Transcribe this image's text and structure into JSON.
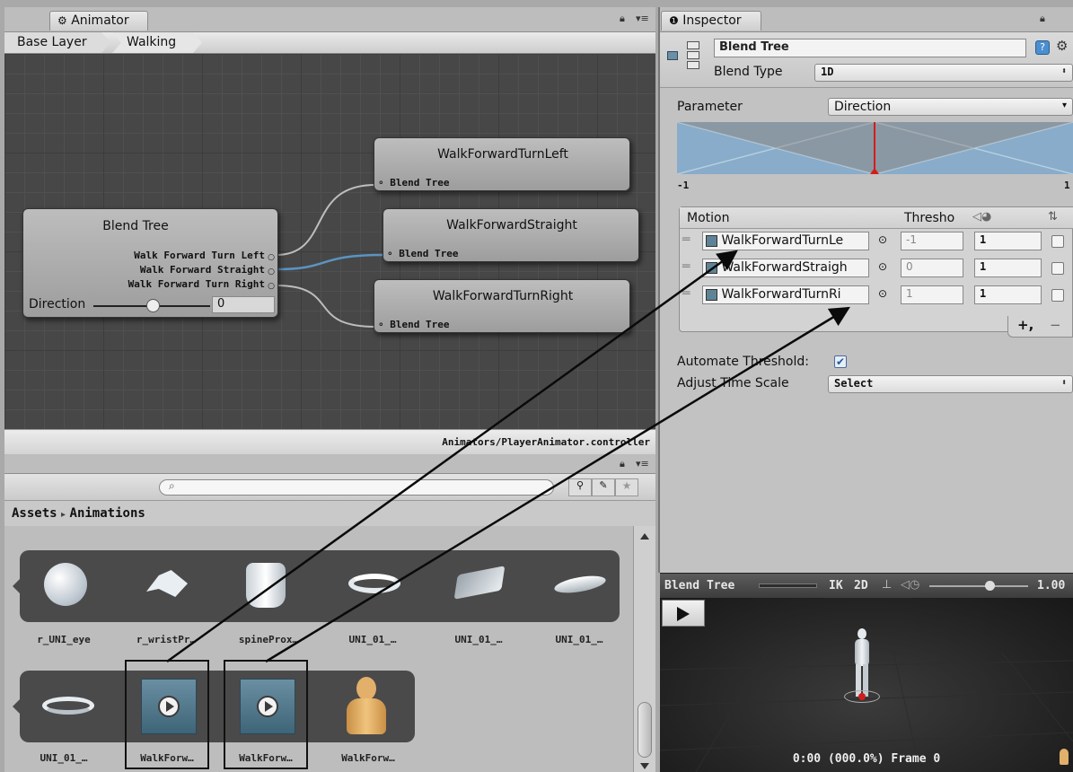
{
  "animator": {
    "tab_label": "Animator",
    "breadcrumb": [
      "Base Layer",
      "Walking"
    ],
    "status_path": "Animators/PlayerAnimator.controller",
    "root_node": {
      "title": "Blend Tree",
      "outputs": [
        "Walk Forward Turn Left",
        "Walk Forward Straight",
        "Walk Forward Turn Right"
      ],
      "param_label": "Direction",
      "param_value": "0"
    },
    "child_nodes": [
      {
        "title": "WalkForwardTurnLeft",
        "port": "Blend Tree"
      },
      {
        "title": "WalkForwardStraight",
        "port": "Blend Tree"
      },
      {
        "title": "WalkForwardTurnRight",
        "port": "Blend Tree"
      }
    ],
    "param_slider_fraction": 0.5
  },
  "project": {
    "search_placeholder": "",
    "breadcrumb_root": "Assets",
    "breadcrumb_sep": "▸",
    "breadcrumb_current": "Animations",
    "assets_row1": [
      {
        "label": "r_UNI_eye",
        "icon": "sphere-mesh-icon"
      },
      {
        "label": "r_wristPr…",
        "icon": "wrist-mesh-icon"
      },
      {
        "label": "spineProx…",
        "icon": "spine-mesh-icon"
      },
      {
        "label": "UNI_01_…",
        "icon": "ring-mesh-icon"
      },
      {
        "label": "UNI_01_…",
        "icon": "plate-mesh-icon"
      },
      {
        "label": "UNI_01_…",
        "icon": "disc-mesh-icon"
      }
    ],
    "assets_row2": [
      {
        "label": "UNI_01_…",
        "icon": "band-mesh-icon"
      },
      {
        "label": "WalkForw…",
        "icon": "animation-clip-icon"
      },
      {
        "label": "WalkForw…",
        "icon": "animation-clip-icon"
      },
      {
        "label": "WalkForw…",
        "icon": "avatar-icon"
      }
    ]
  },
  "inspector": {
    "tab_label": "Inspector",
    "name_value": "Blend Tree",
    "blend_type_label": "Blend Type",
    "blend_type_value": "1D",
    "parameter_label": "Parameter",
    "parameter_value": "Direction",
    "range_min": "-1",
    "range_max": "1",
    "table_headers": {
      "motion": "Motion",
      "threshold": "Thresho"
    },
    "motions": [
      {
        "name": "WalkForwardTurnLe",
        "threshold": "-1",
        "speed": "1"
      },
      {
        "name": "WalkForwardStraigh",
        "threshold": "0",
        "speed": "1"
      },
      {
        "name": "WalkForwardTurnRi",
        "threshold": "1",
        "speed": "1"
      }
    ],
    "add_label": "+,",
    "remove_label": "−",
    "automate_label": "Automate Threshold",
    "automate_checked": true,
    "adjust_label": "Adjust Time Scale",
    "adjust_value": "Select"
  },
  "preview": {
    "title": "Blend Tree",
    "ik_label": "IK",
    "mode_label": "2D",
    "speed_value": "1.00",
    "status": "0:00 (000.0%) Frame 0"
  },
  "colors": {
    "selection": "#5a94c2",
    "marker": "#d21c1c",
    "graph_bg": "#474747"
  }
}
